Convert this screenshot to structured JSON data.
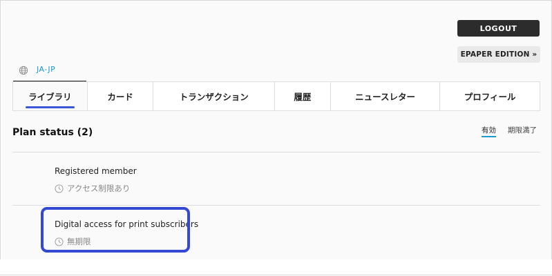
{
  "header": {
    "logout_label": "LOGOUT",
    "epaper_label": "EPAPER EDITION »"
  },
  "language": {
    "code": "JA-JP",
    "icon": "globe-icon"
  },
  "tabs": [
    {
      "label": "ライブラリ",
      "active": true
    },
    {
      "label": "カード",
      "active": false
    },
    {
      "label": "トランザクション",
      "active": false
    },
    {
      "label": "履歴",
      "active": false
    },
    {
      "label": "ニュースレター",
      "active": false
    },
    {
      "label": "プロフィール",
      "active": false
    }
  ],
  "plans": {
    "title": "Plan status (2)",
    "filters": {
      "active": "有効",
      "expired": "期限満了"
    },
    "items": [
      {
        "name": "Registered member",
        "status": "アクセス制限あり",
        "icon": "clock-icon"
      },
      {
        "name": "Digital access for print subscribers",
        "status": "無期限",
        "icon": "clock-icon"
      }
    ]
  },
  "colors": {
    "accent_blue": "#3b56d8",
    "link_teal": "#1b9ad0",
    "dark_button": "#2c2c2c",
    "highlight_border": "#3349d4"
  }
}
